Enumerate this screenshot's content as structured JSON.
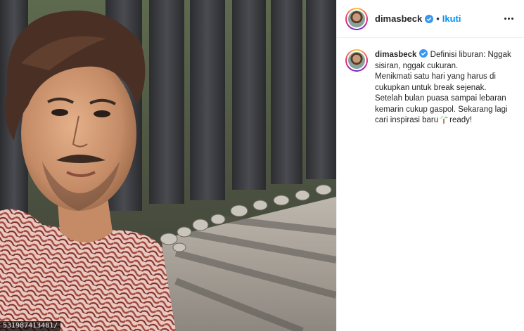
{
  "post": {
    "username": "dimasbeck",
    "follow_label": "Ikuti",
    "separator": "•",
    "caption_lines": [
      "Definisi liburan: Nggak",
      "sisiran, nggak cukuran.",
      "Menikmati satu hari yang harus di",
      "cukupkan untuk break sejenak.",
      "Setelah bulan puasa sampai lebaran",
      "kemarin cukup gaspol. Sekarang lagi",
      "cari inspirasi baru",
      "ready!"
    ],
    "emoji_name": "palm-tree"
  },
  "photo": {
    "watermark": "531987413481/"
  },
  "colors": {
    "accent": "#0095f6",
    "text": "#262626",
    "border": "#efefef"
  },
  "icons": {
    "verified": "verified-badge-icon",
    "more": "more-options-icon"
  }
}
